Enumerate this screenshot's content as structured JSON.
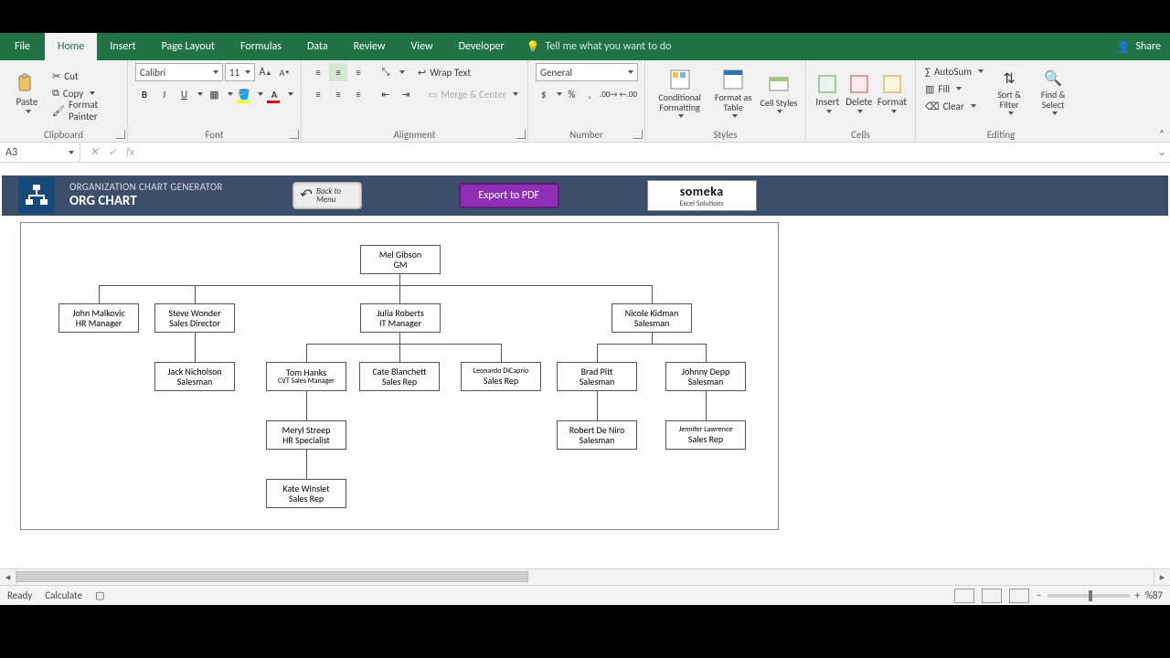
{
  "tabs": {
    "file": "File",
    "list": [
      "Home",
      "Insert",
      "Page Layout",
      "Formulas",
      "Data",
      "Review",
      "View",
      "Developer"
    ],
    "active": "Home",
    "tellme": "Tell me what you want to do",
    "share": "Share"
  },
  "ribbon": {
    "clipboard": {
      "label": "Clipboard",
      "paste": "Paste",
      "cut": "Cut",
      "copy": "Copy",
      "painter": "Format Painter"
    },
    "font": {
      "label": "Font",
      "name": "Calibri",
      "size": "11",
      "bold": "B",
      "italic": "I",
      "underline": "U"
    },
    "alignment": {
      "label": "Alignment",
      "wrap": "Wrap Text",
      "merge": "Merge & Center"
    },
    "number": {
      "label": "Number",
      "format": "General"
    },
    "styles": {
      "label": "Styles",
      "cond": "Conditional Formatting",
      "table": "Format as Table",
      "cell": "Cell Styles"
    },
    "cells": {
      "label": "Cells",
      "insert": "Insert",
      "delete": "Delete",
      "format": "Format"
    },
    "editing": {
      "label": "Editing",
      "autosum": "AutoSum",
      "fill": "Fill",
      "clear": "Clear",
      "sort": "Sort & Filter",
      "find": "Find & Select"
    }
  },
  "formula_bar": {
    "cell": "A3",
    "fx": "fx",
    "value": ""
  },
  "orgband": {
    "small": "ORGANIZATION CHART GENERATOR",
    "big": "ORG CHART",
    "back": "Back to Menu",
    "export": "Export to PDF",
    "brand1": "someka",
    "brand2": "Excel Solutions"
  },
  "chart_data": {
    "type": "tree",
    "nodes": [
      {
        "id": "n1",
        "name": "Mel Gibson",
        "title": "GM"
      },
      {
        "id": "n2",
        "name": "John Malkovic",
        "title": "HR Manager",
        "parent": "n1"
      },
      {
        "id": "n3",
        "name": "Steve Wonder",
        "title": "Sales Director",
        "parent": "n1"
      },
      {
        "id": "n4",
        "name": "Julia Roberts",
        "title": "IT Manager",
        "parent": "n1"
      },
      {
        "id": "n5",
        "name": "Nicole Kidman",
        "title": "Salesman",
        "parent": "n1"
      },
      {
        "id": "n6",
        "name": "Jack Nicholson",
        "title": "Salesman",
        "parent": "n3"
      },
      {
        "id": "n7",
        "name": "Tom Hanks",
        "title": "CVT Sales Manager",
        "parent": "n4"
      },
      {
        "id": "n8",
        "name": "Cate Blanchett",
        "title": "Sales Rep",
        "parent": "n4"
      },
      {
        "id": "n9",
        "name": "Leonardo DiCaprio",
        "title": "Sales Rep",
        "parent": "n4"
      },
      {
        "id": "n10",
        "name": "Brad Pitt",
        "title": "Salesman",
        "parent": "n5"
      },
      {
        "id": "n11",
        "name": "Johnny Depp",
        "title": "Salesman",
        "parent": "n5"
      },
      {
        "id": "n12",
        "name": "Meryl Streep",
        "title": "HR Specialist",
        "parent": "n7"
      },
      {
        "id": "n13",
        "name": "Robert De Niro",
        "title": "Salesman",
        "parent": "n10"
      },
      {
        "id": "n14",
        "name": "Jennifer Lawrence",
        "title": "Sales Rep",
        "parent": "n11"
      },
      {
        "id": "n15",
        "name": "Kate Winslet",
        "title": "Sales Rep",
        "parent": "n12"
      }
    ]
  },
  "status": {
    "ready": "Ready",
    "calc": "Calculate",
    "zoom": "%87"
  }
}
